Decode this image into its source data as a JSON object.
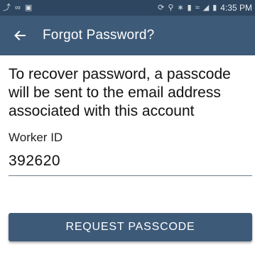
{
  "status_bar": {
    "time": "4:35 PM",
    "left_icons": [
      "notification-icon",
      "voicemail-icon",
      "image-icon"
    ],
    "right_icons": [
      "sync-icon",
      "location-icon",
      "bluetooth-icon",
      "vibrate-icon",
      "wifi-icon",
      "signal-icon",
      "battery-icon"
    ]
  },
  "app_bar": {
    "title": "Forgot Password?",
    "background": "#3d5a78"
  },
  "instructions": "To recover password, a passcode will be sent to the email address associated with this account",
  "form": {
    "worker_id_label": "Worker ID",
    "worker_id_value": "392620"
  },
  "actions": {
    "request_label": "REQUEST PASSCODE"
  }
}
